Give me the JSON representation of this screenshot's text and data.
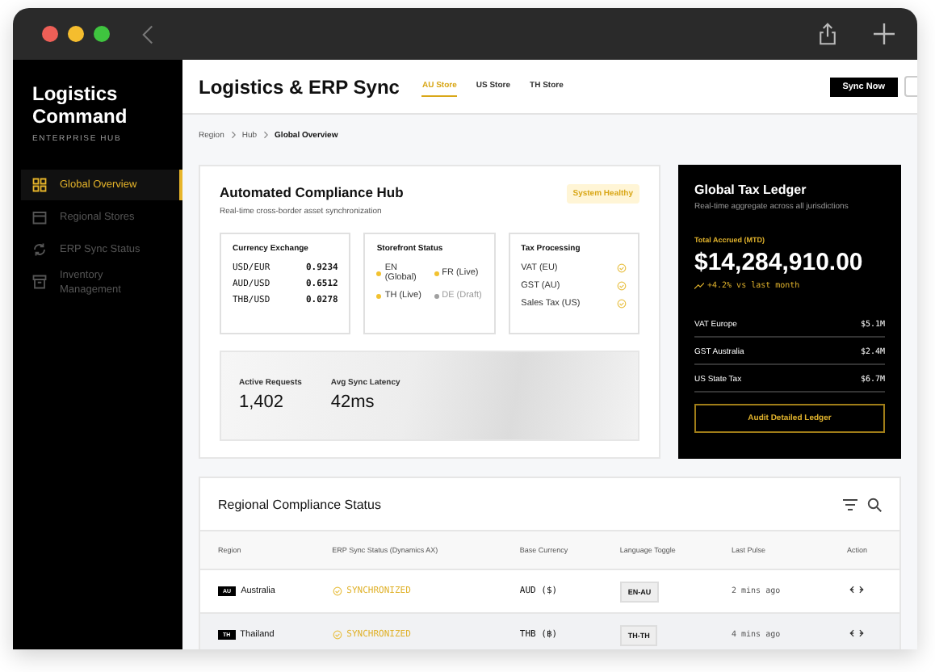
{
  "sidebar": {
    "title": "Logistics Command",
    "subtitle": "ENTERPRISE HUB",
    "items": [
      {
        "label": "Global Overview",
        "selected": true
      },
      {
        "label": "Regional Stores",
        "selected": false
      },
      {
        "label": "ERP Sync Status",
        "selected": false
      },
      {
        "label": "Inventory Management",
        "selected": false
      }
    ]
  },
  "header": {
    "title": "Logistics & ERP Sync",
    "tabs": [
      {
        "label": "AU Store",
        "selected": true
      },
      {
        "label": "US Store",
        "selected": false
      },
      {
        "label": "TH Store",
        "selected": false
      }
    ],
    "button": "Sync Now"
  },
  "breadcrumb": [
    "Region",
    "Hub",
    "Global Overview"
  ],
  "compliance": {
    "title": "Automated Compliance Hub",
    "subtitle": "Real-time cross-border asset synchronization",
    "badge": "System Healthy",
    "currency": {
      "title": "Currency Exchange",
      "rows": [
        {
          "pair": "USD/EUR",
          "rate": "0.9234"
        },
        {
          "pair": "AUD/USD",
          "rate": "0.6512"
        },
        {
          "pair": "THB/USD",
          "rate": "0.0278"
        }
      ]
    },
    "storefront": {
      "title": "Storefront Status",
      "items": [
        {
          "label": "EN (Global)",
          "color": "#f2c230"
        },
        {
          "label": "FR (Live)",
          "color": "#f2c230"
        },
        {
          "label": "TH (Live)",
          "color": "#f2c230"
        },
        {
          "label": "DE (Draft)",
          "color": "#a0a0a0"
        }
      ]
    },
    "tax": {
      "title": "Tax Processing",
      "items": [
        "VAT (EU)",
        "GST (AU)",
        "Sales Tax (US)"
      ]
    },
    "stats": [
      {
        "label": "Active Requests",
        "value": "1,402"
      },
      {
        "label": "Avg Sync Latency",
        "value": "42ms"
      }
    ]
  },
  "ledger": {
    "title": "Global Tax Ledger",
    "subtitle": "Real-time aggregate across all jurisdictions",
    "total_label": "Total Accrued (MTD)",
    "total": "$14,284,910.00",
    "trend": "+4.2% vs last month",
    "rows": [
      {
        "label": "VAT Europe",
        "value": "$5.1M"
      },
      {
        "label": "GST Australia",
        "value": "$2.4M"
      },
      {
        "label": "US State Tax",
        "value": "$6.7M"
      }
    ],
    "button": "Audit Detailed Ledger"
  },
  "table": {
    "title": "Regional Compliance Status",
    "columns": [
      "Region",
      "ERP Sync Status (Dynamics AX)",
      "Base Currency",
      "Language Toggle",
      "Last Pulse",
      "Action"
    ],
    "rows": [
      {
        "code": "AU",
        "region": "Australia",
        "status": "SYNCHRONIZED",
        "currency": "AUD ($)",
        "language": "EN-AU",
        "pulse": "2 mins ago",
        "selected": false
      },
      {
        "code": "TH",
        "region": "Thailand",
        "status": "SYNCHRONIZED",
        "currency": "THB (฿)",
        "language": "TH-TH",
        "pulse": "4 mins ago",
        "selected": true
      }
    ]
  }
}
